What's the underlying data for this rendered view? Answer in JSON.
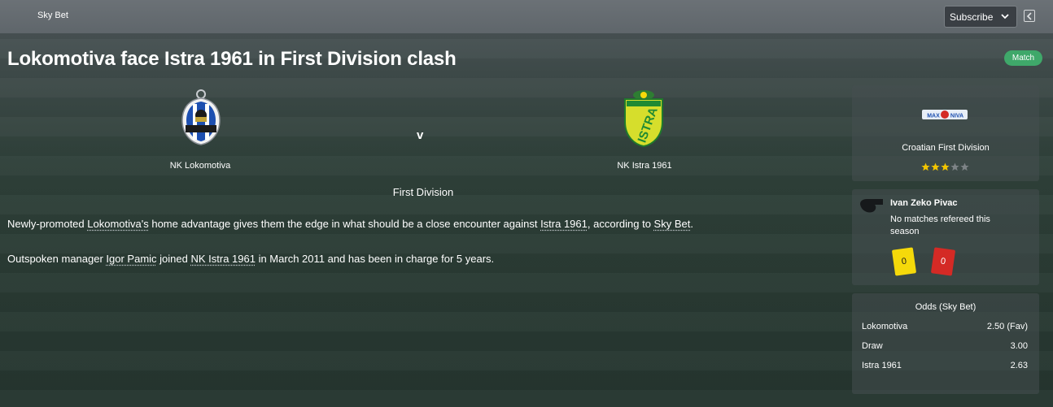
{
  "header": {
    "source": "Sky Bet",
    "subscribe_label": "Subscribe"
  },
  "article": {
    "headline": "Lokomotiva face Istra 1961 in First Division clash",
    "badge": "Match",
    "home_team": "NK Lokomotiva",
    "away_team": "NK Istra 1961",
    "versus": "v",
    "competition": "First Division",
    "p1": {
      "t1": "Newly-promoted ",
      "l1": "Lokomotiva's",
      "t2": " home advantage gives them the edge in what should be a close encounter against ",
      "l2": "Istra 1961",
      "t3": ", according to ",
      "l3": "Sky Bet",
      "t4": "."
    },
    "p2": {
      "t1": "Outspoken manager ",
      "l1": "Igor Pamic",
      "t2": " joined ",
      "l2": "NK Istra 1961",
      "t3": " in March 2011 and has been in charge for 5 years."
    }
  },
  "league_panel": {
    "name": "Croatian First Division",
    "logo_text": "MAX  ·  NIVA",
    "rating": 3,
    "rating_max": 5
  },
  "referee_panel": {
    "name": "Ivan Zeko Pivac",
    "note": "No matches refereed this season",
    "yellow_cards": "0",
    "red_cards": "0"
  },
  "odds_panel": {
    "title": "Odds (Sky Bet)",
    "rows": [
      {
        "label": "Lokomotiva",
        "value": "2.50 (Fav)"
      },
      {
        "label": "Draw",
        "value": "3.00"
      },
      {
        "label": "Istra 1961",
        "value": "2.63"
      }
    ]
  },
  "colors": {
    "match_badge": "#3fa86a",
    "star_filled": "#f2c500",
    "star_empty": "#7d8386",
    "yellow_card": "#f5d90a",
    "red_card": "#d42a25"
  }
}
